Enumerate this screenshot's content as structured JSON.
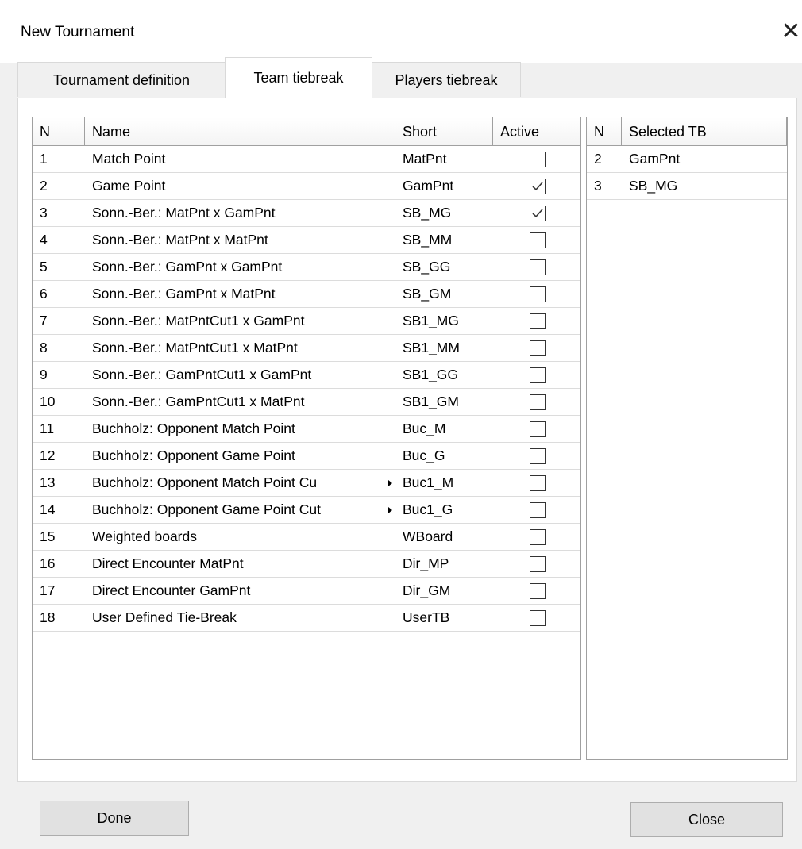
{
  "window": {
    "title": "New Tournament"
  },
  "tabs": [
    {
      "label": "Tournament definition"
    },
    {
      "label": "Team tiebreak"
    },
    {
      "label": "Players tiebreak"
    }
  ],
  "tiebreaks": {
    "columns": {
      "n": "N",
      "name": "Name",
      "short": "Short",
      "active": "Active"
    },
    "rows": [
      {
        "n": "1",
        "name": "Match Point",
        "short": "MatPnt",
        "active": false
      },
      {
        "n": "2",
        "name": "Game Point",
        "short": "GamPnt",
        "active": true
      },
      {
        "n": "3",
        "name": "Sonn.-Ber.: MatPnt x GamPnt",
        "short": "SB_MG",
        "active": true
      },
      {
        "n": "4",
        "name": "Sonn.-Ber.: MatPnt x MatPnt",
        "short": "SB_MM",
        "active": false
      },
      {
        "n": "5",
        "name": "Sonn.-Ber.: GamPnt x GamPnt",
        "short": "SB_GG",
        "active": false
      },
      {
        "n": "6",
        "name": "Sonn.-Ber.: GamPnt x MatPnt",
        "short": "SB_GM",
        "active": false
      },
      {
        "n": "7",
        "name": "Sonn.-Ber.: MatPntCut1 x GamPnt",
        "short": "SB1_MG",
        "active": false
      },
      {
        "n": "8",
        "name": "Sonn.-Ber.: MatPntCut1 x MatPnt",
        "short": "SB1_MM",
        "active": false
      },
      {
        "n": "9",
        "name": "Sonn.-Ber.: GamPntCut1 x GamPnt",
        "short": "SB1_GG",
        "active": false
      },
      {
        "n": "10",
        "name": "Sonn.-Ber.: GamPntCut1 x MatPnt",
        "short": "SB1_GM",
        "active": false
      },
      {
        "n": "11",
        "name": "Buchholz: Opponent Match Point",
        "short": "Buc_M",
        "active": false
      },
      {
        "n": "12",
        "name": "Buchholz: Opponent Game Point",
        "short": "Buc_G",
        "active": false
      },
      {
        "n": "13",
        "name": "Buchholz: Opponent Match Point Cu",
        "short": "Buc1_M",
        "active": false,
        "truncated": true
      },
      {
        "n": "14",
        "name": "Buchholz: Opponent Game Point Cut",
        "short": "Buc1_G",
        "active": false,
        "truncated": true
      },
      {
        "n": "15",
        "name": "Weighted boards",
        "short": "WBoard",
        "active": false
      },
      {
        "n": "16",
        "name": "Direct Encounter MatPnt",
        "short": "Dir_MP",
        "active": false
      },
      {
        "n": "17",
        "name": "Direct Encounter GamPnt",
        "short": "Dir_GM",
        "active": false
      },
      {
        "n": "18",
        "name": "User Defined Tie-Break",
        "short": "UserTB",
        "active": false
      }
    ]
  },
  "selected": {
    "columns": {
      "n": "N",
      "selected": "Selected TB"
    },
    "rows": [
      {
        "n": "2",
        "selected": "GamPnt"
      },
      {
        "n": "3",
        "selected": "SB_MG"
      }
    ]
  },
  "buttons": {
    "done": "Done",
    "close": "Close"
  }
}
